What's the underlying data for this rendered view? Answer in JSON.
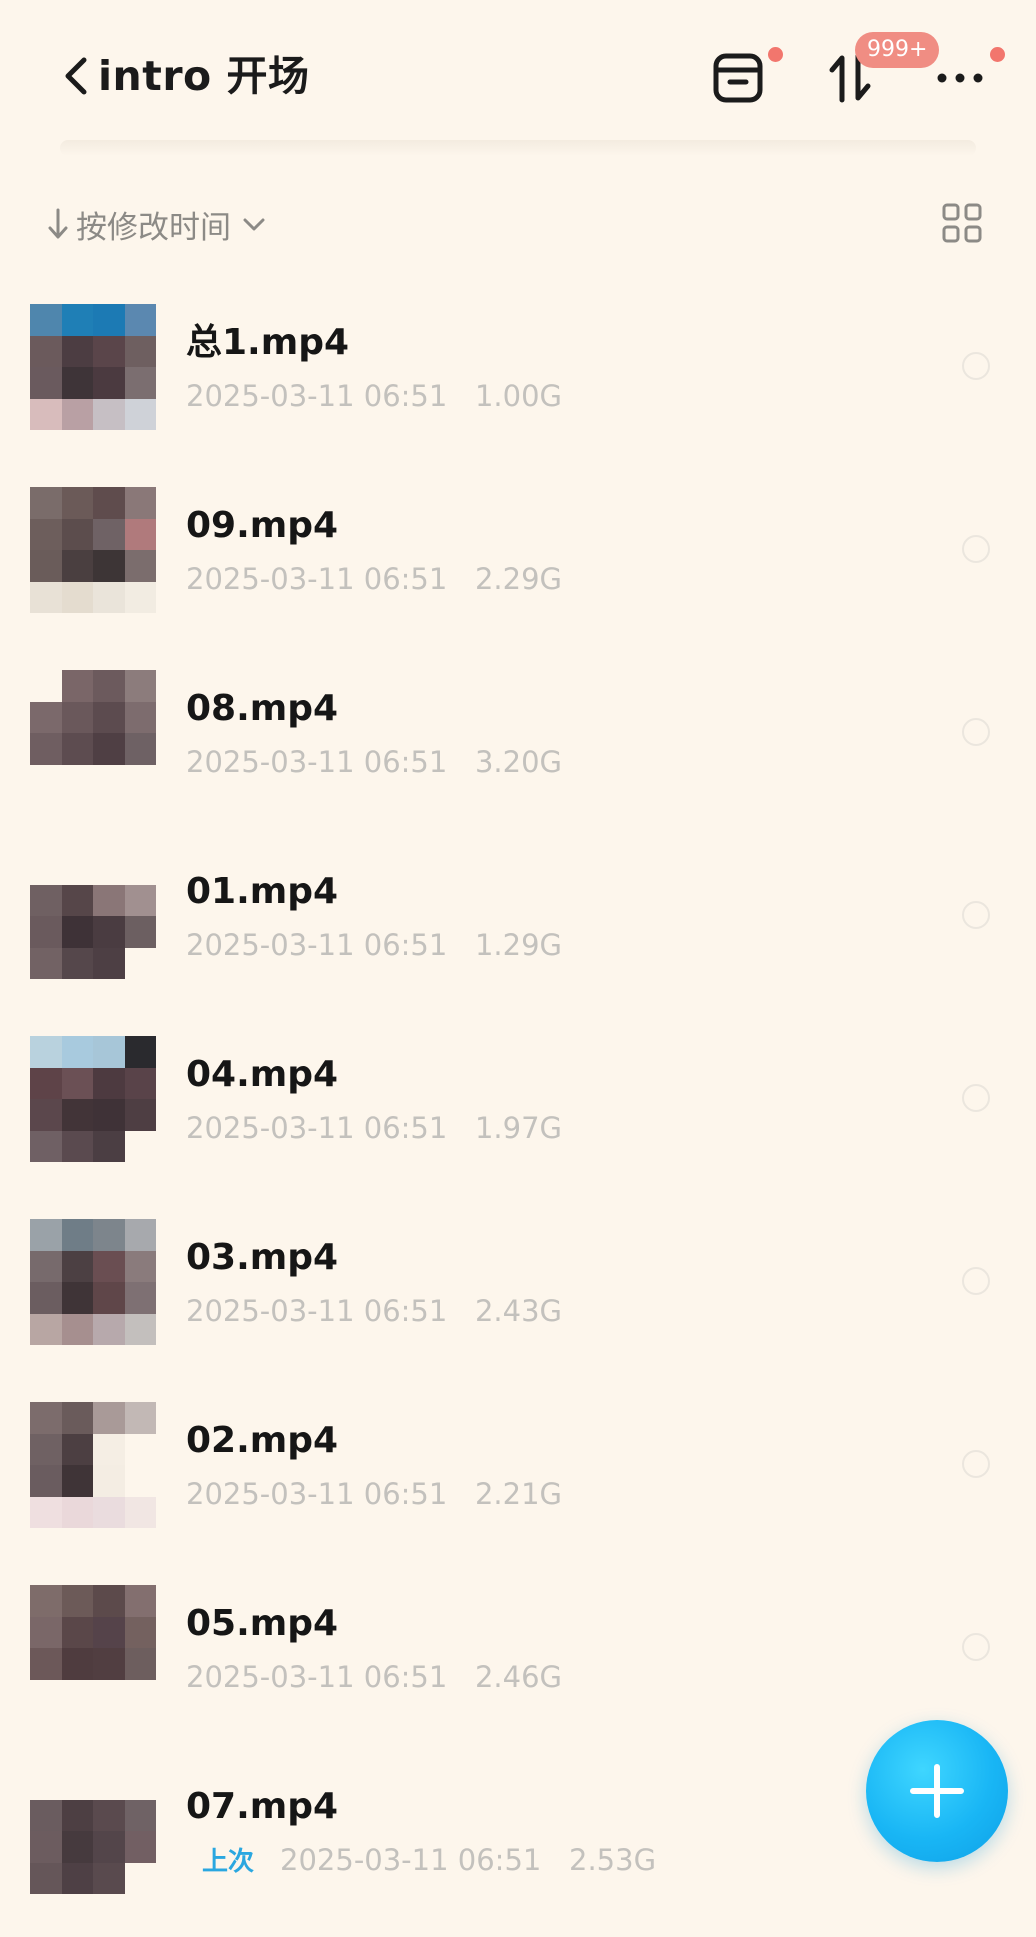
{
  "header": {
    "title": "intro 开场",
    "back_icon": "chevron-left-icon",
    "tray_icon": "inbox-tray-icon",
    "transfer_icon": "transfer-arrows-icon",
    "transfer_badge": "999+",
    "more_icon": "more-dots-icon",
    "dot_color": "#f2766d"
  },
  "sort": {
    "label": "按修改时间",
    "direction_icon": "arrow-down-icon",
    "dropdown_icon": "chevron-down-icon",
    "view_toggle_icon": "grid-view-icon"
  },
  "files": [
    {
      "name": "总1.mp4",
      "date": "2025-03-11 06:51",
      "size": "1.00G"
    },
    {
      "name": "09.mp4",
      "date": "2025-03-11 06:51",
      "size": "2.29G"
    },
    {
      "name": "08.mp4",
      "date": "2025-03-11 06:51",
      "size": "3.20G"
    },
    {
      "name": "01.mp4",
      "date": "2025-03-11 06:51",
      "size": "1.29G"
    },
    {
      "name": "04.mp4",
      "date": "2025-03-11 06:51",
      "size": "1.97G"
    },
    {
      "name": "03.mp4",
      "date": "2025-03-11 06:51",
      "size": "2.43G"
    },
    {
      "name": "02.mp4",
      "date": "2025-03-11 06:51",
      "size": "2.21G"
    },
    {
      "name": "05.mp4",
      "date": "2025-03-11 06:51",
      "size": "2.46G"
    },
    {
      "name": "07.mp4",
      "tag": "上次",
      "date": "2025-03-11 06:51",
      "size": "2.53G"
    }
  ],
  "fab": {
    "icon": "plus-icon",
    "color": "#19b6f5"
  }
}
